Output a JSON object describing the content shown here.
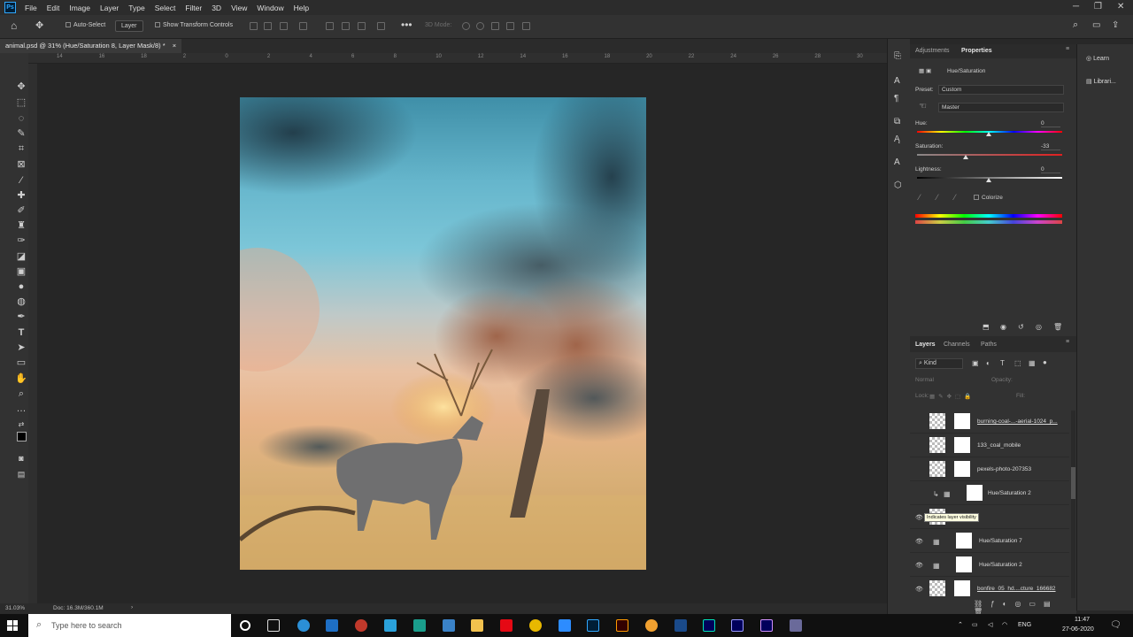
{
  "app": {
    "logo": "Ps"
  },
  "menu": [
    "File",
    "Edit",
    "Image",
    "Layer",
    "Type",
    "Select",
    "Filter",
    "3D",
    "View",
    "Window",
    "Help"
  ],
  "options": {
    "auto_select_label": "Auto-Select",
    "layer_dropdown": "Layer",
    "show_transform_label": "Show Transform Controls",
    "mode_3d": "3D Mode:"
  },
  "document": {
    "tab_title": "animal.psd @ 31% (Hue/Saturation 8, Layer Mask/8) *"
  },
  "ruler_ticks": [
    "14",
    "16",
    "18",
    "2",
    "0",
    "2",
    "4",
    "6",
    "8",
    "10",
    "12",
    "14",
    "16",
    "18",
    "20",
    "22",
    "24",
    "26",
    "28",
    "30"
  ],
  "status": {
    "zoom": "31.03%",
    "doc": "Doc: 16.3M/360.1M"
  },
  "properties": {
    "tabs": [
      "Adjustments",
      "Properties"
    ],
    "layer_type": "Hue/Saturation",
    "preset_label": "Preset:",
    "preset_value": "Custom",
    "channel": "Master",
    "hue_label": "Hue:",
    "hue_value": "0",
    "saturation_label": "Saturation:",
    "saturation_value": "-33",
    "lightness_label": "Lightness:",
    "lightness_value": "0",
    "colorize_label": "Colorize",
    "saturation_level": -33
  },
  "learn": {
    "items": [
      "Learn",
      "Librari..."
    ]
  },
  "layers": {
    "tabs": [
      "Layers",
      "Channels",
      "Paths"
    ],
    "kind_label": "Kind",
    "blend_mode": "Normal",
    "opacity_label": "Opacity:",
    "lock_label": "Lock:",
    "fill_label": "Fill:",
    "tooltip": "Indicates layer visibility",
    "rows": [
      {
        "name": "burning-coal-...-aerial-1024_p...",
        "visible": false,
        "kind": "smart"
      },
      {
        "name": "133_coal_mobile",
        "visible": false,
        "kind": "smart"
      },
      {
        "name": "pexels-photo-207353",
        "visible": false,
        "kind": "smart"
      },
      {
        "name": "Hue/Saturation 2",
        "visible": false,
        "kind": "adjust"
      },
      {
        "name": "",
        "visible": true,
        "kind": "smart"
      },
      {
        "name": "Hue/Saturation 7",
        "visible": true,
        "kind": "adjust"
      },
      {
        "name": "Hue/Saturation 2",
        "visible": true,
        "kind": "adjust"
      },
      {
        "name": "bonfire_05_hd....cture_166682",
        "visible": true,
        "kind": "smart"
      }
    ]
  },
  "taskbar": {
    "search_placeholder": "Type here to search",
    "lang": "ENG",
    "time": "11:47",
    "date": "27-06-2020"
  },
  "colors": {
    "accent": "#31a8ff",
    "panel": "#323232",
    "canvas_bg": "#262626"
  }
}
